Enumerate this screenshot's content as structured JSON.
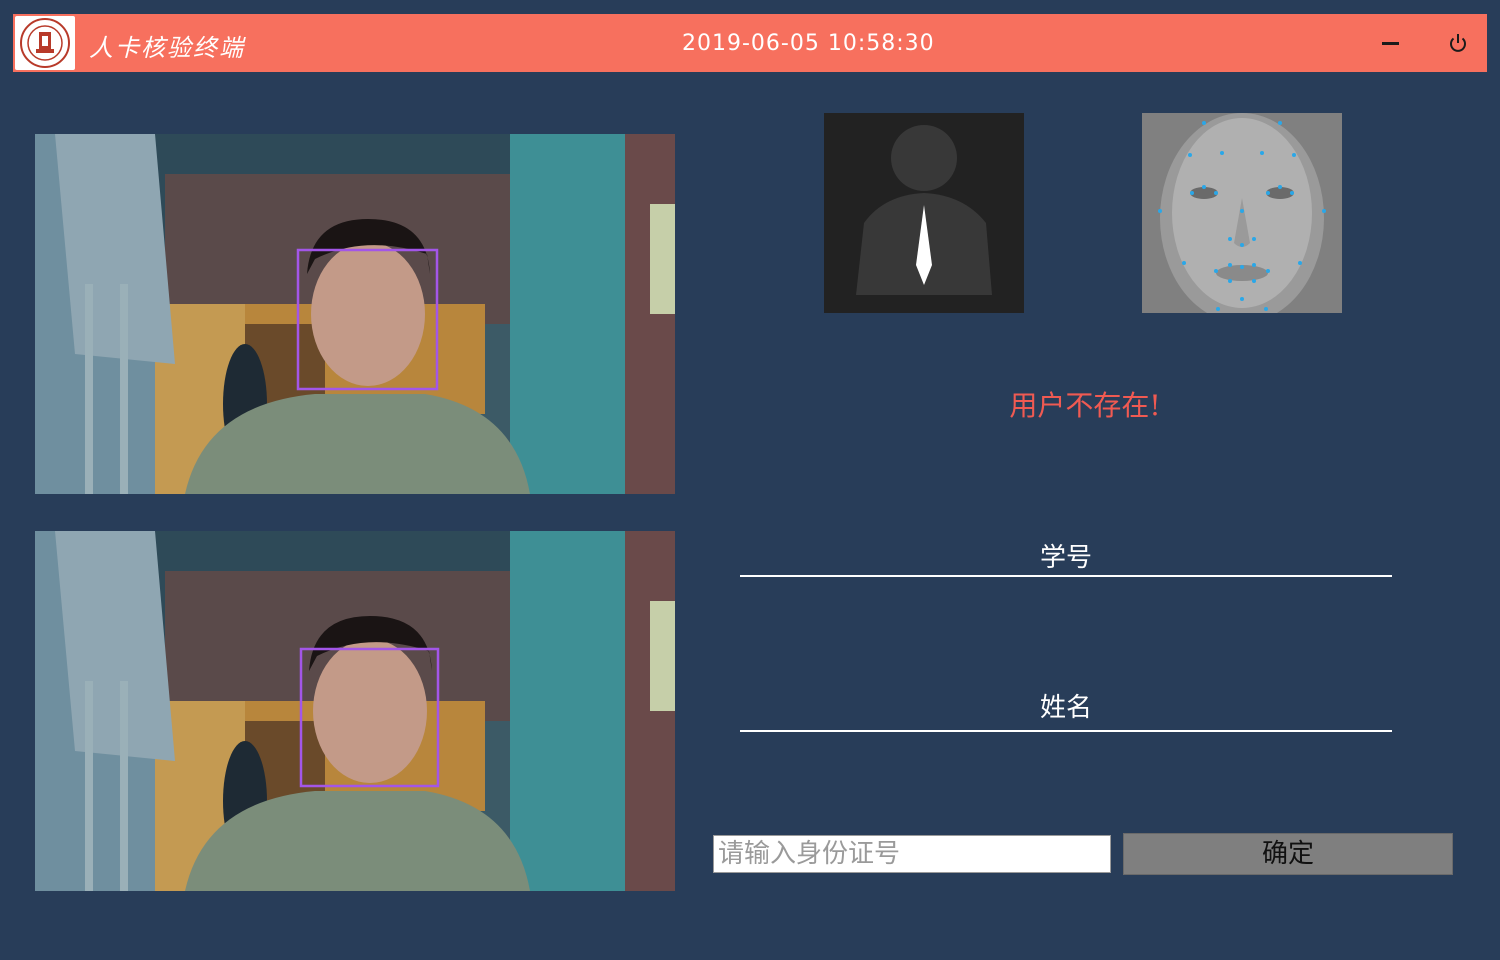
{
  "titlebar": {
    "app_title": "人卡核验终端",
    "datetime": "2019-06-05 10:58:30",
    "background": "#f7705e",
    "icons": {
      "minimize": "minimize-icon",
      "power": "power-icon",
      "logo": "university-seal-logo"
    }
  },
  "status": {
    "message": "用户不存在!",
    "color": "#f05a52"
  },
  "form": {
    "student_id_label": "学号",
    "name_label": "姓名",
    "id_input_placeholder": "请输入身份证号",
    "id_input_value": "",
    "confirm_button": "确定"
  },
  "colors": {
    "page_background": "#283d59",
    "face_box": "#a356e8"
  }
}
